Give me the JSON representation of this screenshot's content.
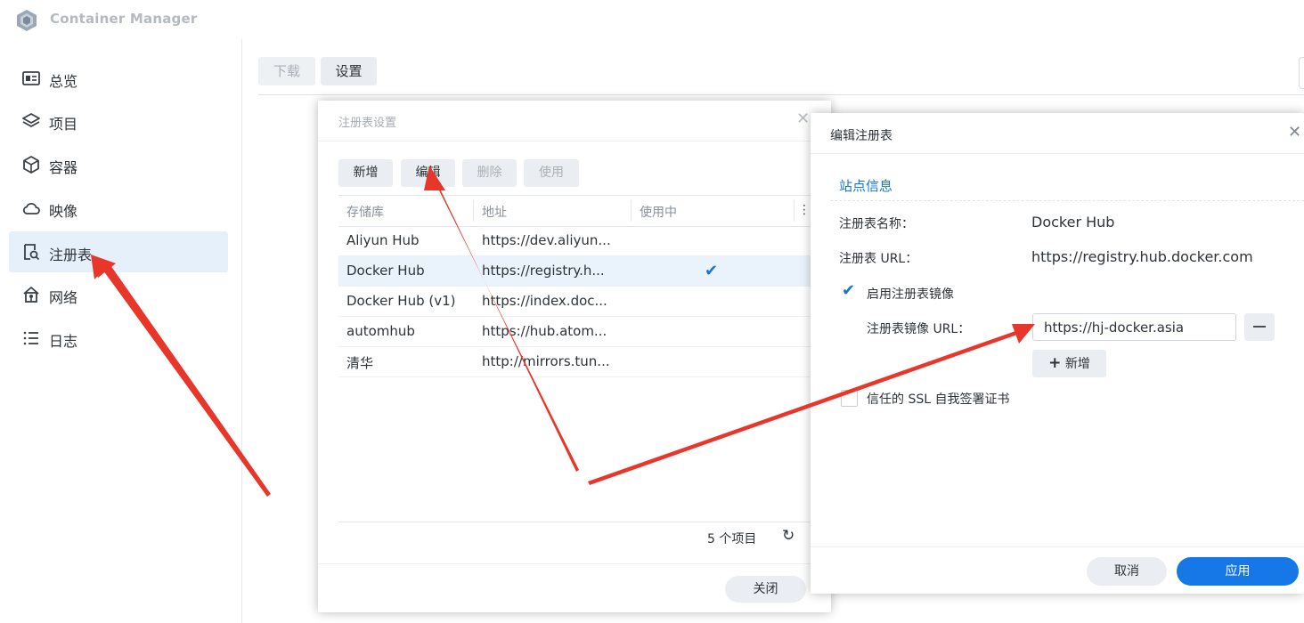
{
  "app": {
    "title": "Container Manager"
  },
  "sidebar": {
    "items": [
      {
        "label": "总览",
        "icon": "overview-icon"
      },
      {
        "label": "项目",
        "icon": "layers-icon"
      },
      {
        "label": "容器",
        "icon": "cube-icon"
      },
      {
        "label": "映像",
        "icon": "cloud-icon"
      },
      {
        "label": "注册表",
        "icon": "registry-search-icon",
        "active": true
      },
      {
        "label": "网络",
        "icon": "network-icon"
      },
      {
        "label": "日志",
        "icon": "list-icon"
      }
    ]
  },
  "main": {
    "toolbar": {
      "download_label": "下载",
      "settings_label": "设置"
    }
  },
  "registry_dialog": {
    "title": "注册表设置",
    "close_glyph": "✕",
    "buttons": {
      "new": "新增",
      "edit": "编辑",
      "delete": "删除",
      "use": "使用"
    },
    "columns": [
      "存储库",
      "地址",
      "使用中"
    ],
    "more_glyph": "⋮",
    "rows": [
      {
        "name": "Aliyun Hub",
        "url": "https://dev.aliyun...",
        "in_use": false
      },
      {
        "name": "Docker Hub",
        "url": "https://registry.h...",
        "in_use": true
      },
      {
        "name": "Docker Hub (v1)",
        "url": "https://index.doc...",
        "in_use": false
      },
      {
        "name": "automhub",
        "url": "https://hub.atom...",
        "in_use": false
      },
      {
        "name": "清华",
        "url": "http://mirrors.tun...",
        "in_use": false
      }
    ],
    "check_glyph": "✔",
    "count": "5 个项目",
    "refresh_glyph": "↻",
    "close_button": "关闭"
  },
  "edit_dialog": {
    "title": "编辑注册表",
    "close_glyph": "✕",
    "section": "站点信息",
    "name_label": "注册表名称：",
    "name_value": "Docker Hub",
    "url_label": "注册表 URL：",
    "url_value": "https://registry.hub.docker.com",
    "enable_mirror_label": "启用注册表镜像",
    "enable_mirror_checked": true,
    "mirror_url_label": "注册表镜像 URL：",
    "mirror_url_value": "https://hj-docker.asia",
    "add_label": "新增",
    "add_glyph": "+",
    "ssl_label": "信任的 SSL 自我签署证书",
    "ssl_checked": false,
    "cancel": "取消",
    "apply": "应用"
  },
  "colors": {
    "accent": "#1677e6",
    "annotation_arrow": "#e8362b",
    "sidebar_active": "#e5f0fb"
  }
}
